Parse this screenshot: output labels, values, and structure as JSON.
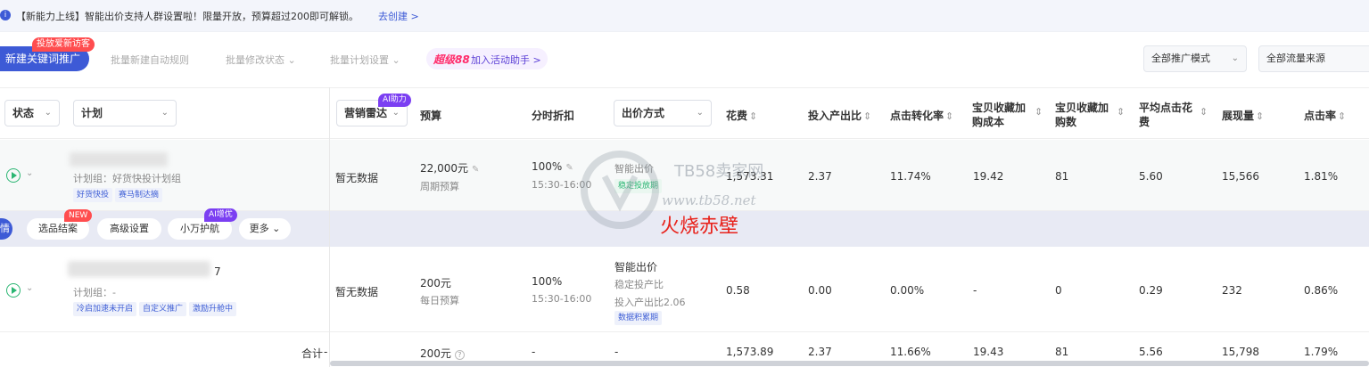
{
  "notice": {
    "icon": "info-icon",
    "text": "【新能力上线】智能出价支持人群设置啦！限量开放，预算超过200即可解锁。",
    "link": "去创建 >"
  },
  "toolbar": {
    "primary_label": "新建关键词推广",
    "primary_badge": "投放爱新访客",
    "batch_rule": "批量新建自动规则",
    "batch_status": "批量修改状态 ⌄",
    "batch_plan": "批量计划设置 ⌄",
    "promo_brand": "超级88",
    "promo_label": "加入活动助手 >",
    "mode_select": "全部推广模式",
    "source_select": "全部流量来源"
  },
  "headers": {
    "status": "状态",
    "plan": "计划",
    "radar": "营销雷达",
    "radar_badge": "AI助力",
    "budget": "预算",
    "time_discount": "分时折扣",
    "bid_mode": "出价方式",
    "cost": "花费",
    "roi": "投入产出比",
    "cvr": "点击转化率",
    "fav_cost": "宝贝收藏加购成本",
    "fav_count": "宝贝收藏加购数",
    "avg_cpc": "平均点击花费",
    "impressions": "展现量",
    "ctr": "点击率"
  },
  "rows": [
    {
      "group": "计划组：好货快投计划组",
      "tags": [
        "好货快投",
        "赛马制达摘"
      ],
      "radar": "暂无数据",
      "budget": "22,000元",
      "budget_type": "周期预算",
      "discount": "100%",
      "discount_time": "15:30-16:00",
      "bid_line1": "智能出价",
      "bid_tag": "稳定投放期",
      "cost": "1,573.31",
      "roi": "2.37",
      "cvr": "11.74%",
      "fav_cost": "19.42",
      "fav_count": "81",
      "avg_cpc": "5.60",
      "impressions": "15,566",
      "ctr": "1.81%"
    },
    {
      "name_suffix": "7",
      "group": "计划组：-",
      "tags": [
        "冷启加速未开启",
        "自定义推广",
        "激励升舱中"
      ],
      "radar": "暂无数据",
      "budget": "200元",
      "budget_type": "每日预算",
      "discount": "100%",
      "discount_time": "15:30-16:00",
      "bid_line1": "智能出价",
      "bid_line2": "稳定投产比",
      "bid_line3": "投入产出比2.06",
      "bid_tag": "数据积累期",
      "cost": "0.58",
      "roi": "0.00",
      "cvr": "0.00%",
      "fav_cost": "-",
      "fav_count": "0",
      "avg_cpc": "0.29",
      "impressions": "232",
      "ctr": "0.86%"
    }
  ],
  "actions": {
    "partial": "情",
    "select_case": "选品结案",
    "select_case_badge": "NEW",
    "advanced": "高级设置",
    "escort": "小万护航",
    "escort_badge": "AI增优",
    "more": "更多 ⌄"
  },
  "total": {
    "label": "合计",
    "radar": "-",
    "budget": "200元",
    "discount": "-",
    "bid": "-",
    "cost": "1,573.89",
    "roi": "2.37",
    "cvr": "11.66%",
    "fav_cost": "19.43",
    "fav_count": "81",
    "avg_cpc": "5.56",
    "impressions": "15,798",
    "ctr": "1.79%"
  },
  "watermark": {
    "title": "TB58卖家网",
    "url": "www.tb58.net",
    "overlay": "火烧赤壁"
  },
  "colors": {
    "accent": "#3d5ad6",
    "status_green": "#2bb673",
    "badge_red": "#ff4d4f",
    "ai_purple": "#7b3ff2",
    "overlay_red": "#e8221b"
  }
}
